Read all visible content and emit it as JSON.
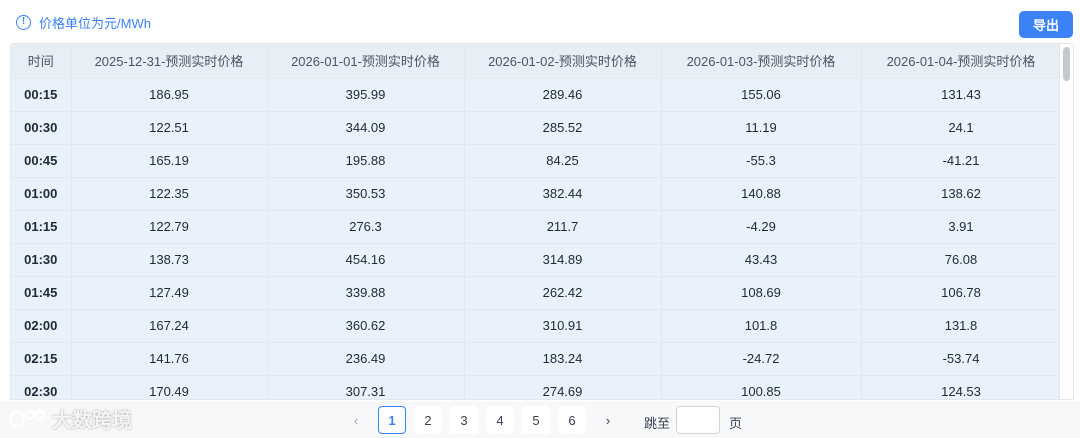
{
  "notice": {
    "text": "价格单位为元/MWh"
  },
  "toolbar": {
    "export_label": "导出"
  },
  "table": {
    "headers": [
      "时间",
      "2025-12-31-预测实时价格",
      "2026-01-01-预测实时价格",
      "2026-01-02-预测实时价格",
      "2026-01-03-预测实时价格",
      "2026-01-04-预测实时价格"
    ],
    "rows": [
      [
        "00:15",
        "186.95",
        "395.99",
        "289.46",
        "155.06",
        "131.43"
      ],
      [
        "00:30",
        "122.51",
        "344.09",
        "285.52",
        "11.19",
        "24.1"
      ],
      [
        "00:45",
        "165.19",
        "195.88",
        "84.25",
        "-55.3",
        "-41.21"
      ],
      [
        "01:00",
        "122.35",
        "350.53",
        "382.44",
        "140.88",
        "138.62"
      ],
      [
        "01:15",
        "122.79",
        "276.3",
        "211.7",
        "-4.29",
        "3.91"
      ],
      [
        "01:30",
        "138.73",
        "454.16",
        "314.89",
        "43.43",
        "76.08"
      ],
      [
        "01:45",
        "127.49",
        "339.88",
        "262.42",
        "108.69",
        "106.78"
      ],
      [
        "02:00",
        "167.24",
        "360.62",
        "310.91",
        "101.8",
        "131.8"
      ],
      [
        "02:15",
        "141.76",
        "236.49",
        "183.24",
        "-24.72",
        "-53.74"
      ],
      [
        "02:30",
        "170.49",
        "307.31",
        "274.69",
        "100.85",
        "124.53"
      ]
    ]
  },
  "pagination": {
    "prev": "‹",
    "next": "›",
    "pages": [
      "1",
      "2",
      "3",
      "4",
      "5",
      "6"
    ],
    "current": "1",
    "jump_label": "跳至",
    "page_suffix": "页"
  },
  "watermark": {
    "text": "大数跨境"
  }
}
